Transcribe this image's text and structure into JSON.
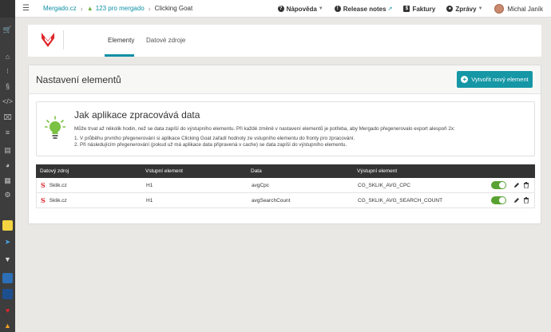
{
  "topbar": {
    "breadcrumb": [
      {
        "label": "Mergado.cz"
      },
      {
        "label": "123 pro mergado"
      },
      {
        "label": "Clicking Goat"
      }
    ],
    "help": "Nápověda",
    "release_notes": "Release notes",
    "invoices": "Faktury",
    "messages": "Zprávy",
    "user": "Michal Janík"
  },
  "app": {
    "tabs": [
      {
        "label": "Elementy",
        "active": true
      },
      {
        "label": "Datové zdroje",
        "active": false
      }
    ]
  },
  "main": {
    "title": "Nastavení elementů",
    "create_button": "Vytvořit nový element",
    "info": {
      "title": "Jak aplikace zpracovává data",
      "text": "Může trvat až několik hodin, než se data zapíší do výstupního elementu. Při každé změně v nastavení elementů je potřeba, aby Mergado přegenerovalo export alespoň 2x:",
      "steps": [
        "1. V průběhu prvního přegenerování si aplikace Clicking Goat zařadí hodnoty ze vstupního elementu do fronty pro zpracování.",
        "2. Při následujícím přegenerování (pokud už má aplikace data připravená v cache) se data zapíší do výstupního elementu."
      ]
    },
    "table": {
      "headers": [
        "Datový zdroj",
        "Vstupní element",
        "Data",
        "Výstupní element"
      ],
      "rows": [
        {
          "source": "Sklik.cz",
          "input": "H1",
          "data": "avgCpc",
          "output": "CG_SKLIK_AVG_CPC",
          "enabled": true
        },
        {
          "source": "Sklik.cz",
          "input": "H1",
          "data": "avgSearchCount",
          "output": "CG_SKLIK_AVG_SEARCH_COUNT",
          "enabled": true
        }
      ]
    }
  },
  "colors": {
    "accent": "#0d8fa5",
    "button": "#1597a5",
    "toggle_on": "#58a233",
    "sidebar": "#3d3d3d"
  }
}
